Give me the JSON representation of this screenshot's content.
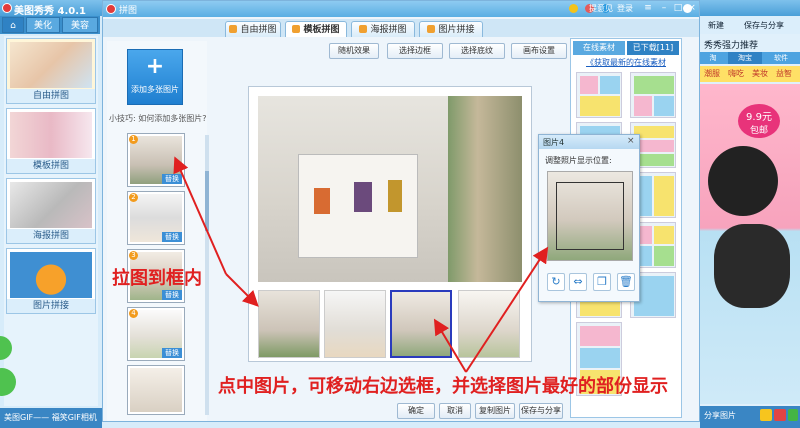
{
  "app": {
    "title": "美图秀秀 4.0.1",
    "nav_tabs": [
      "美化",
      "美容"
    ],
    "modules": [
      "自由拼图",
      "模板拼图",
      "海报拼图",
      "图片拼接"
    ],
    "status_text": "美图GIF—— 福笑GIF相机"
  },
  "window": {
    "title": "拼图",
    "login": "登录",
    "feedback": "提意见",
    "tabs": [
      "自由拼图",
      "模板拼图",
      "海报拼图",
      "图片拼接"
    ],
    "active_tab": "模板拼图"
  },
  "left_panel": {
    "add_label": "添加多张图片",
    "add_symbol": "+",
    "tip": "小技巧: 如何添加多张图片?",
    "replace_label": "替换"
  },
  "toolbar": {
    "random": "随机效果",
    "border": "选择边框",
    "background": "选择底纹",
    "canvas": "画布设置"
  },
  "bottom_buttons": {
    "ok": "确定",
    "cancel": "取消",
    "copy": "复制图片",
    "save": "保存与分享"
  },
  "template_panel": {
    "tabs": [
      "在线素材",
      "已下载[11]"
    ],
    "link": "《获取最新的在线素材"
  },
  "popup": {
    "title": "图片4",
    "close": "×",
    "subtitle": "调整照片显示位置:",
    "buttons": [
      "↻",
      "⇔",
      "❐",
      "🗑"
    ]
  },
  "right_panel": {
    "new": "新建",
    "save": "保存与分享",
    "heading": "秀秀强力推荐",
    "tabs": [
      "淘",
      "淘宝",
      "软件"
    ],
    "tags": [
      "潮服",
      "嗨吃",
      "美妆",
      "益智"
    ],
    "price": "9.9元",
    "price_sub": "包邮",
    "share": "分享图片"
  },
  "annotations": {
    "drag": "拉图到框内",
    "click": "点中图片，可移动右边选框，并选择图片最好的部份显示"
  },
  "colors": {
    "accent": "#3b8fcc",
    "annotation": "#e02020",
    "selection": "#2a3bbd"
  }
}
